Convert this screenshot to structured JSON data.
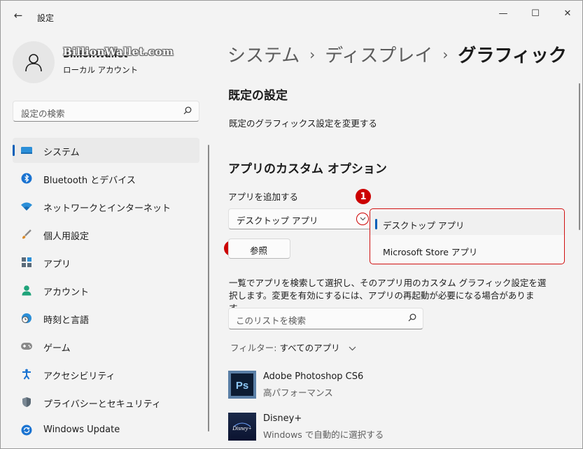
{
  "window": {
    "title": "設定",
    "back_icon": "←",
    "minimize_icon": "—",
    "maximize_icon": "☐",
    "close_icon": "✕"
  },
  "user": {
    "name": "BillionWallet",
    "account_type": "ローカル アカウント",
    "watermark": "BillionWallet.com"
  },
  "sidebar": {
    "search_placeholder": "設定の検索",
    "items": [
      {
        "label": "システム",
        "icon": "system-icon",
        "active": true
      },
      {
        "label": "Bluetooth とデバイス",
        "icon": "bluetooth-icon"
      },
      {
        "label": "ネットワークとインターネット",
        "icon": "network-icon"
      },
      {
        "label": "個人用設定",
        "icon": "personalization-icon"
      },
      {
        "label": "アプリ",
        "icon": "apps-icon"
      },
      {
        "label": "アカウント",
        "icon": "account-icon"
      },
      {
        "label": "時刻と言語",
        "icon": "time-language-icon"
      },
      {
        "label": "ゲーム",
        "icon": "gaming-icon"
      },
      {
        "label": "アクセシビリティ",
        "icon": "accessibility-icon"
      },
      {
        "label": "プライバシーとセキュリティ",
        "icon": "privacy-icon"
      },
      {
        "label": "Windows Update",
        "icon": "windows-update-icon"
      }
    ]
  },
  "breadcrumb": {
    "items": [
      "システム",
      "ディスプレイ"
    ],
    "current": "グラフィック",
    "separator": "›"
  },
  "default_settings": {
    "title": "既定の設定",
    "link": "既定のグラフィックス設定を変更する"
  },
  "custom_options": {
    "title": "アプリのカスタム オプション",
    "add_app_label": "アプリを追加する",
    "combo_value": "デスクトップ アプリ",
    "dropdown_options": [
      "デスクトップ アプリ",
      "Microsoft Store アプリ"
    ],
    "browse_label": "参照",
    "badge_1": "1",
    "badge_2": "2"
  },
  "description": "一覧でアプリを検索して選択し、そのアプリ用のカスタム グラフィック設定を選択します。変更を有効にするには、アプリの再起動が必要になる場合があります。",
  "list_search_placeholder": "このリストを検索",
  "filter": {
    "label": "フィルター:",
    "value": "すべてのアプリ"
  },
  "apps": [
    {
      "name": "Adobe Photoshop CS6",
      "setting": "高パフォーマンス",
      "icon": "photoshop-icon",
      "icon_text": "Ps"
    },
    {
      "name": "Disney+",
      "setting": "Windows で自動的に選択する",
      "icon": "disney-plus-icon",
      "icon_text": "Disney+"
    }
  ],
  "colors": {
    "accent": "#005fb8",
    "annotation_red": "#cc0000"
  }
}
